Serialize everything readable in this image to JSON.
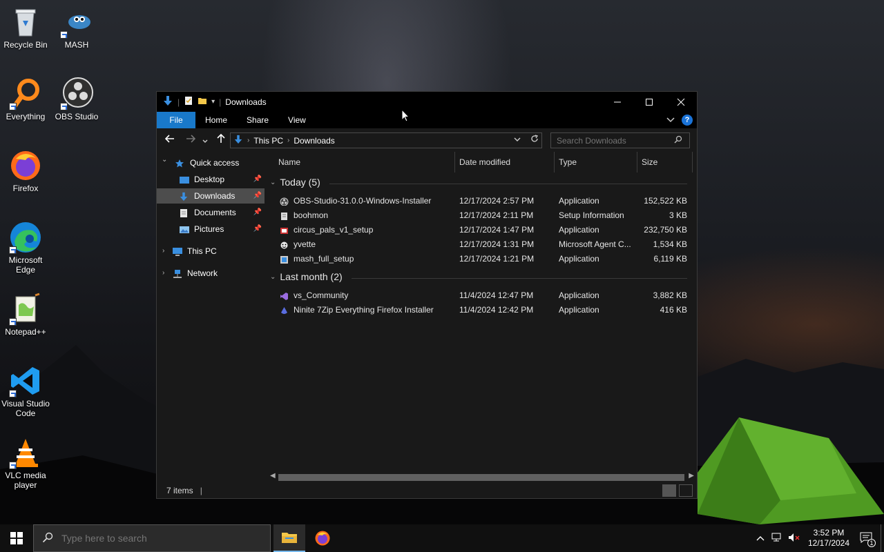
{
  "desktop": {
    "icons": [
      {
        "label": "Recycle Bin",
        "icon": "recycle-bin-icon"
      },
      {
        "label": "MASH",
        "icon": "mash-icon"
      },
      {
        "label": "Everything",
        "icon": "everything-search-icon"
      },
      {
        "label": "OBS Studio",
        "icon": "obs-icon"
      },
      {
        "label": "Firefox",
        "icon": "firefox-icon"
      },
      {
        "label": "Microsoft Edge",
        "icon": "edge-icon"
      },
      {
        "label": "Notepad++",
        "icon": "notepadpp-icon"
      },
      {
        "label": "Visual Studio Code",
        "icon": "vscode-icon"
      },
      {
        "label": "VLC media player",
        "icon": "vlc-icon"
      }
    ]
  },
  "window": {
    "title": "Downloads",
    "ribbon_tabs": [
      "File",
      "Home",
      "Share",
      "View"
    ],
    "address": {
      "crumbs": [
        "This PC",
        "Downloads"
      ]
    },
    "search": {
      "placeholder": "Search Downloads"
    },
    "nav_pane": {
      "quick_access": "Quick access",
      "items": [
        "Desktop",
        "Downloads",
        "Documents",
        "Pictures"
      ],
      "this_pc": "This PC",
      "network": "Network"
    },
    "columns": [
      "Name",
      "Date modified",
      "Type",
      "Size"
    ],
    "groups": [
      {
        "label": "Today (5)",
        "files": [
          {
            "name": "OBS-Studio-31.0.0-Windows-Installer",
            "date": "12/17/2024 2:57 PM",
            "type": "Application",
            "size": "152,522 KB",
            "icon": "obs-installer-icon"
          },
          {
            "name": "boohmon",
            "date": "12/17/2024 2:11 PM",
            "type": "Setup Information",
            "size": "3 KB",
            "icon": "setup-info-icon"
          },
          {
            "name": "circus_pals_v1_setup",
            "date": "12/17/2024 1:47 PM",
            "type": "Application",
            "size": "232,750 KB",
            "icon": "installer-icon"
          },
          {
            "name": "yvette",
            "date": "12/17/2024 1:31 PM",
            "type": "Microsoft Agent C...",
            "size": "1,534 KB",
            "icon": "agent-icon"
          },
          {
            "name": "mash_full_setup",
            "date": "12/17/2024 1:21 PM",
            "type": "Application",
            "size": "6,119 KB",
            "icon": "setup-icon"
          }
        ]
      },
      {
        "label": "Last month (2)",
        "files": [
          {
            "name": "vs_Community",
            "date": "11/4/2024 12:47 PM",
            "type": "Application",
            "size": "3,882 KB",
            "icon": "visual-studio-icon"
          },
          {
            "name": "Ninite 7Zip Everything Firefox Installer",
            "date": "11/4/2024 12:42 PM",
            "type": "Application",
            "size": "416 KB",
            "icon": "ninite-icon"
          }
        ]
      }
    ],
    "status": {
      "items": "7 items"
    }
  },
  "taskbar": {
    "search_placeholder": "Type here to search",
    "clock_time": "3:52 PM",
    "clock_date": "12/17/2024",
    "notification_count": "1"
  },
  "colors": {
    "accent": "#1979ca",
    "selected": "#4d4d4d",
    "window_bg": "#191919"
  }
}
